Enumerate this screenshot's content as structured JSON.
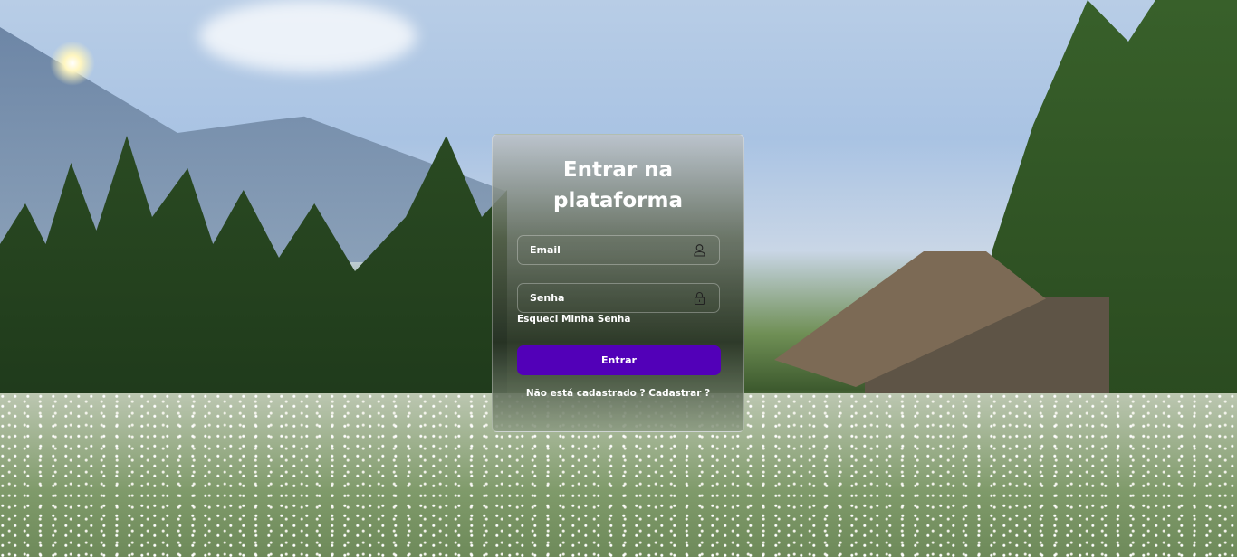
{
  "login": {
    "title_line1": "Entrar na",
    "title_line2": "plataforma",
    "email_placeholder": "Email",
    "email_icon": "user-icon",
    "password_placeholder": "Senha",
    "password_icon": "lock-icon",
    "forgot_password": "Esqueci Minha Senha",
    "submit_label": "Entrar",
    "signup_text": "Não está cadastrado ? Cadastrar ?"
  },
  "colors": {
    "button": "#5200b8",
    "text": "#ffffff"
  }
}
